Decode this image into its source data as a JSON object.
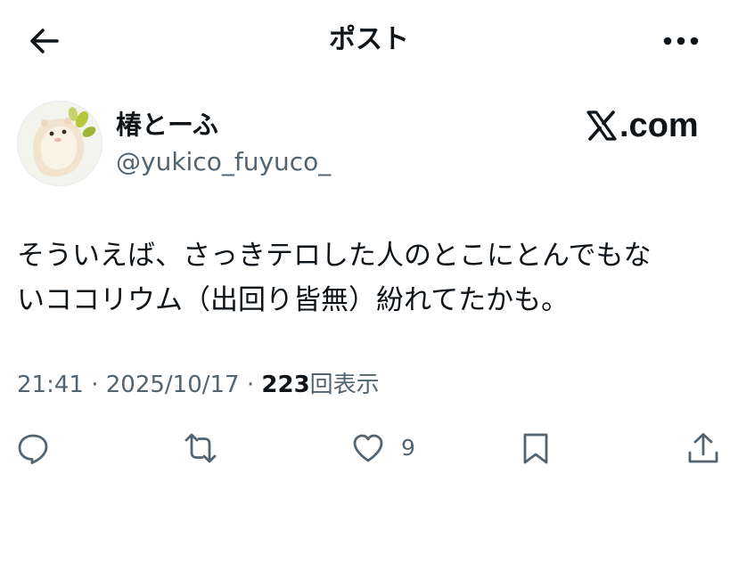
{
  "header": {
    "title": "ポスト"
  },
  "icons": {
    "back": "arrow-left-icon",
    "more": "more-horizontal-icon"
  },
  "author": {
    "display_name": "椿とーふ",
    "handle": "@yukico_fuyuco_"
  },
  "brand": {
    "logo_text": ".com"
  },
  "post": {
    "text": "そういえば、さっきテロした人のとこにとんでもな\nいココリウム（出回り皆無）紛れてたかも。"
  },
  "meta": {
    "time": "21:41",
    "sep1": " · ",
    "date": "2025/10/17",
    "sep2": " · ",
    "views_count": "223",
    "views_label": "回表示"
  },
  "actions": {
    "like_count": "9"
  },
  "colors": {
    "text": "#0f1419",
    "secondary": "#536471"
  }
}
